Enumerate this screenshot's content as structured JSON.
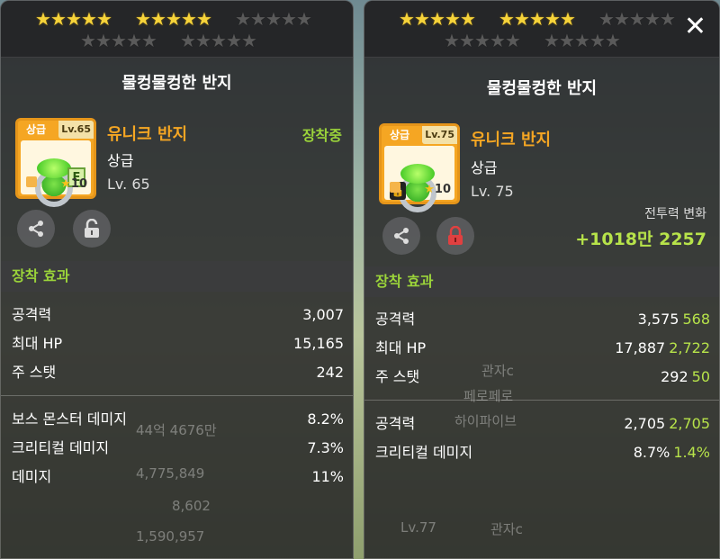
{
  "left": {
    "stars_row1": [
      5,
      5,
      0
    ],
    "stars_row2": [
      0,
      0
    ],
    "item_name": "물컹물컹한 반지",
    "grade_tag": "상급",
    "lv_tag": "Lv.65",
    "star_count": "10",
    "kind": "유니크 반지",
    "grade": "상급",
    "level": "Lv. 65",
    "equipped": "장착중",
    "section": "장착 효과",
    "stats_main": [
      {
        "label": "공격력",
        "value": "3,007"
      },
      {
        "label": "최대 HP",
        "value": "15,165"
      },
      {
        "label": "주 스탯",
        "value": "242"
      }
    ],
    "stats_extra": [
      {
        "label": "보스 몬스터 데미지",
        "value": "8.2%"
      },
      {
        "label": "크리티컬 데미지",
        "value": "7.3%"
      },
      {
        "label": "데미지",
        "value": "11%"
      }
    ],
    "ghost_values": [
      "44억 4676만",
      "4,775,849",
      "8,602",
      "1,590,957"
    ]
  },
  "right": {
    "stars_row1": [
      5,
      5,
      0
    ],
    "stars_row2": [
      0,
      0
    ],
    "item_name": "물컹물컹한 반지",
    "grade_tag": "상급",
    "lv_tag": "Lv.75",
    "star_count": "10",
    "kind": "유니크 반지",
    "grade": "상급",
    "level": "Lv. 75",
    "power_label": "전투력 변화",
    "power_value": "+1018만 2257",
    "section": "장착 효과",
    "stats_main": [
      {
        "label": "공격력",
        "value": "3,575",
        "inc": "568"
      },
      {
        "label": "최대 HP",
        "value": "17,887",
        "inc": "2,722"
      },
      {
        "label": "주 스탯",
        "value": "292",
        "inc": "50"
      }
    ],
    "stats_extra": [
      {
        "label": "공격력",
        "value": "2,705",
        "inc": "2,705"
      },
      {
        "label": "크리티컬 데미지",
        "value": "8.7%",
        "inc": "1.4%"
      }
    ],
    "ghost_values": [
      "관자c",
      "페로페로",
      "하이파이브",
      "Lv.77",
      "관자c"
    ]
  },
  "colors": {
    "accent_green": "#9bd43a",
    "unique_orange": "#f5a623",
    "lock_red": "#e04040"
  },
  "icons": [
    "share-icon",
    "unlock-icon",
    "lock-icon",
    "close-icon",
    "star-icon"
  ]
}
